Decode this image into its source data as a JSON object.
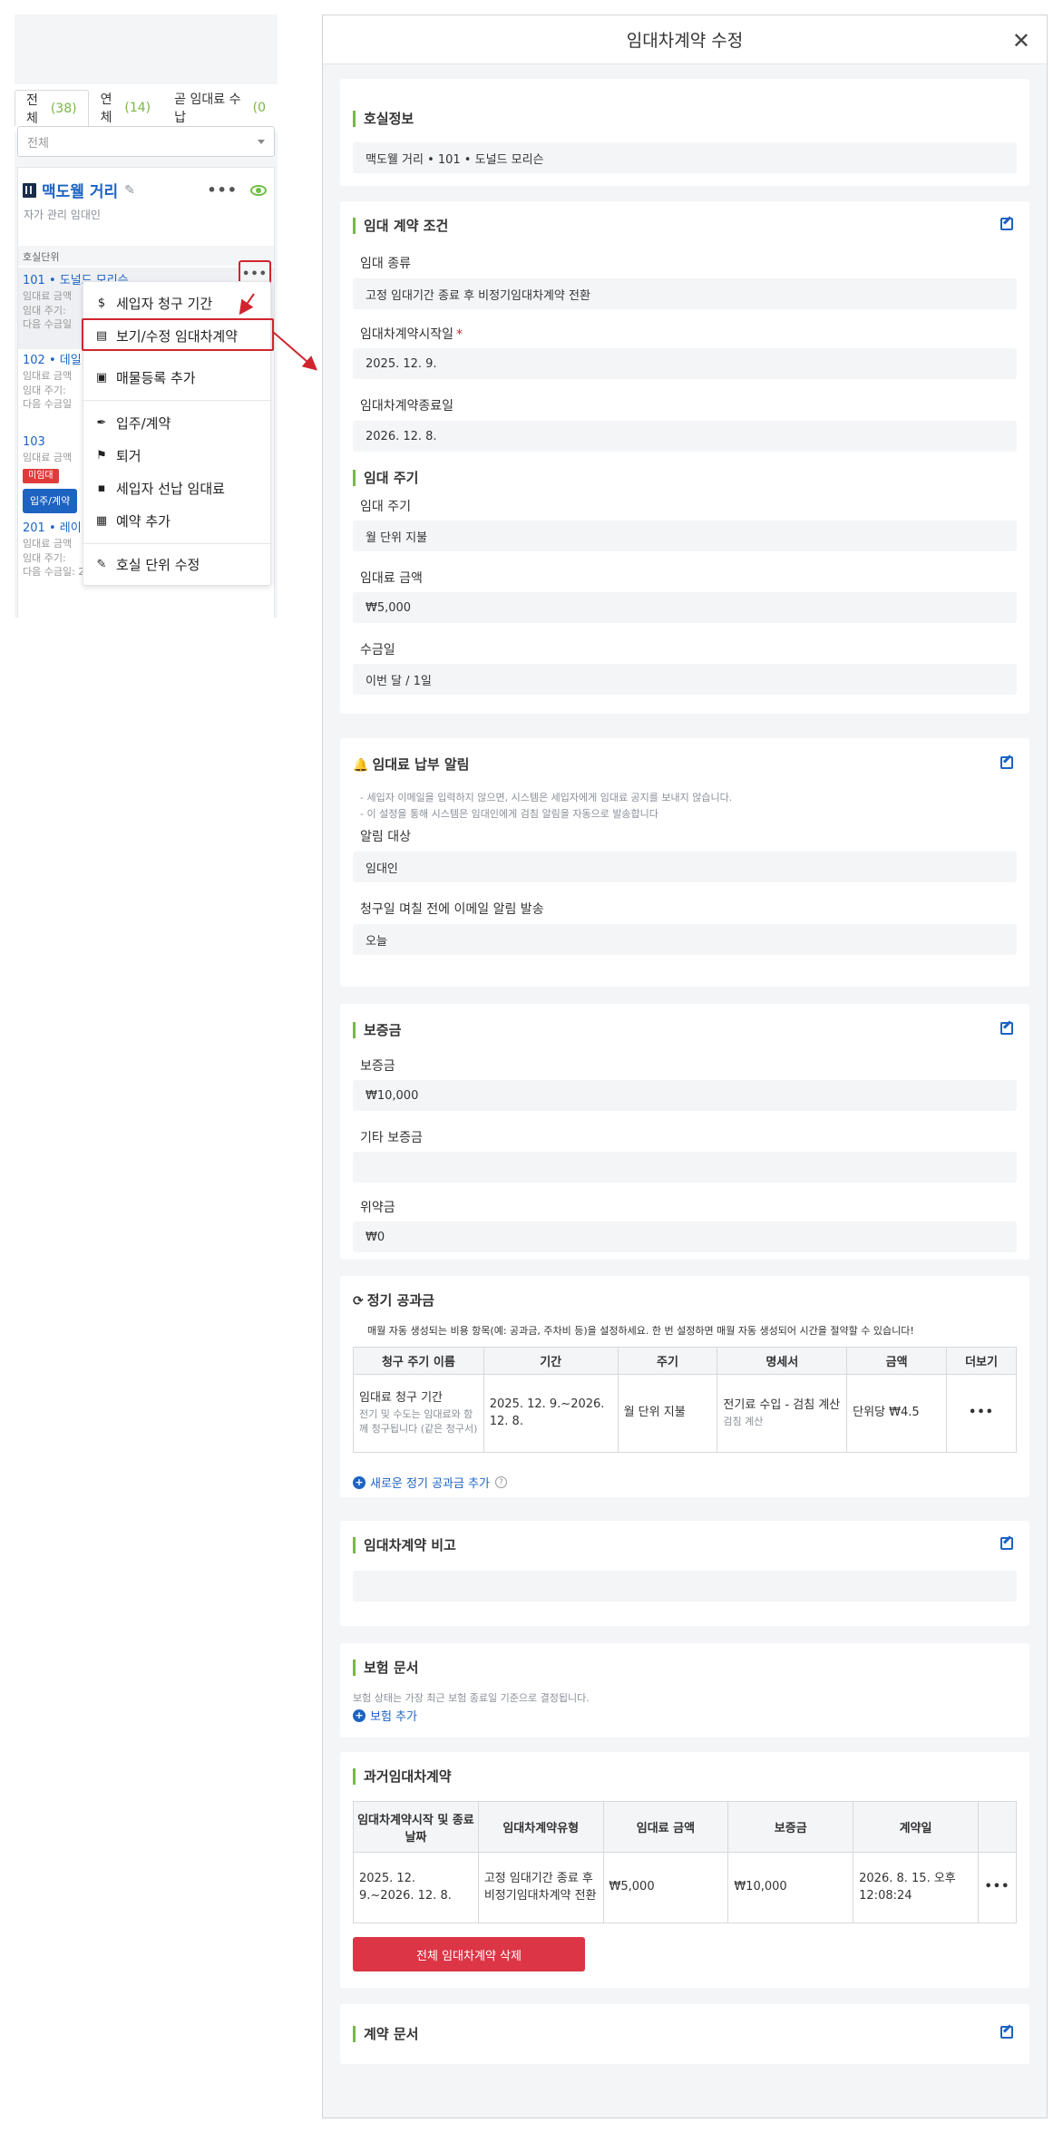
{
  "left": {
    "tabs": [
      {
        "label": "전체",
        "count": "(38)"
      },
      {
        "label": "연체",
        "count": "(14)"
      },
      {
        "label": "곧 임대료 수납",
        "count": "(0"
      }
    ],
    "filter_value": "전체",
    "property": {
      "name": "맥도웰 거리",
      "owner": "자가 관리 임대인"
    },
    "unit_section_label": "호실단위",
    "units": [
      {
        "title": "101 • 도널드 모리슨",
        "l1": "임대료 금액",
        "l2": "임대 주기:",
        "l3": "다음 수금일"
      },
      {
        "title": "102 • 데일",
        "l1": "임대료 금액",
        "l2": "임대 주기:",
        "l3": "다음 수금일"
      },
      {
        "title": "103",
        "l1": "임대료 금액",
        "badge": "미임대",
        "button": "입주/계약"
      },
      {
        "title": "201 • 레이",
        "l1": "임대료 금액",
        "l2": "임대 주기:",
        "l3": "다음 수금일: 2026. 9. 8."
      }
    ],
    "menu": [
      {
        "label": "세입자 청구 기간",
        "icon": "dollar-icon",
        "glyph": "$"
      },
      {
        "label": "보기/수정 임대차계약",
        "icon": "document-icon",
        "glyph": "▤"
      },
      {
        "label": "매물등록 추가",
        "icon": "ad-icon",
        "glyph": "▣"
      },
      {
        "label": "입주/계약",
        "icon": "pen-icon",
        "glyph": "✒"
      },
      {
        "label": "퇴거",
        "icon": "walk-icon",
        "glyph": "⚑"
      },
      {
        "label": "세입자 선납 임대료",
        "icon": "prepay-icon",
        "glyph": "▪"
      },
      {
        "label": "예약 추가",
        "icon": "calendar-icon",
        "glyph": "▦"
      },
      {
        "label": "호실 단위 수정",
        "icon": "edit-icon",
        "glyph": "✎"
      }
    ]
  },
  "modal": {
    "title": "임대차계약 수정",
    "room_info": {
      "title": "호실정보",
      "value": "맥도웰 거리 • 101 • 도널드 모리슨"
    },
    "lease_terms": {
      "title": "임대 계약 조건",
      "type_label": "임대 종류",
      "type_value": "고정 임대기간 종료 후 비정기임대차계약 전환",
      "start_label": "임대차계약시작일",
      "start_required": "*",
      "start_value": "2025. 12. 9.",
      "end_label": "임대차계약종료일",
      "end_value": "2026. 12. 8."
    },
    "rent_cycle": {
      "title": "임대 주기",
      "cycle_label": "임대 주기",
      "cycle_value": "월 단위 지불",
      "amount_label": "임대료 금액",
      "amount_value": "₩5,000",
      "day_label": "수금일",
      "day_value": "이번 달 / 1일"
    },
    "reminder": {
      "title": "임대료 납부 알림",
      "note1": "- 세입자 이메일을 입력하지 않으면, 시스템은 세입자에게 임대료 공지를 보내지 않습니다.",
      "note2": "- 이 설정을 통해 시스템은 임대인에게 검침 알림을 자동으로 발송합니다",
      "target_label": "알림 대상",
      "target_value": "임대인",
      "days_label": "청구일 며칠 전에 이메일 알림 발송",
      "days_value": "오늘"
    },
    "deposit": {
      "title": "보증금",
      "deposit_label": "보증금",
      "deposit_value": "₩10,000",
      "other_label": "기타 보증금",
      "other_value": "",
      "penalty_label": "위약금",
      "penalty_value": "₩0"
    },
    "utilities": {
      "title": "정기 공과금",
      "description": "매월 자동 생성되는 비용 항목(예: 공과금, 주차비 등)을 설정하세요. 한 번 설정하면 매월 자동 생성되어 시간을 절약할 수 있습니다!",
      "headers": [
        "청구 주기 이름",
        "기간",
        "주기",
        "명세서",
        "금액",
        "더보기"
      ],
      "row": {
        "name": "임대료 청구 기간",
        "name_sub": "전기 및 수도는 임대료와 함께 청구됩니다 (같은 청구서)",
        "period": "2025. 12. 9.~2026. 12. 8.",
        "cycle": "월 단위 지불",
        "statement": "전기료 수입 - 검침 계산",
        "statement_sub": "검침 계산",
        "amount": "단위당 ₩4.5",
        "more": "•••"
      },
      "add_link": "새로운 정기 공과금 추가",
      "help": "?"
    },
    "remarks": {
      "title": "임대차계약 비고",
      "value": ""
    },
    "insurance": {
      "title": "보험 문서",
      "note": "보험 상태는 가장 최근 보험 종료일 기준으로 결정됩니다.",
      "add_link": "보험 추가"
    },
    "past_leases": {
      "title": "과거임대차계약",
      "headers": [
        "임대차계약시작 및 종료 날짜",
        "임대차계약유형",
        "임대료 금액",
        "보증금",
        "계약일",
        ""
      ],
      "row": {
        "dates": "2025. 12. 9.~2026. 12. 8.",
        "type": "고정 임대기간 종료 후 비정기임대차계약 전환",
        "rent": "₩5,000",
        "deposit": "₩10,000",
        "signed": "2026. 8. 15. 오후 12:08:24",
        "more": "•••"
      },
      "delete_button": "전체 임대차계약 삭제"
    },
    "contract_docs": {
      "title": "계약 문서"
    }
  },
  "colors": {
    "accent_blue": "#1d63c2",
    "accent_green": "#7ab648",
    "danger_red": "#dc3545",
    "highlight_red": "#d0252e"
  }
}
